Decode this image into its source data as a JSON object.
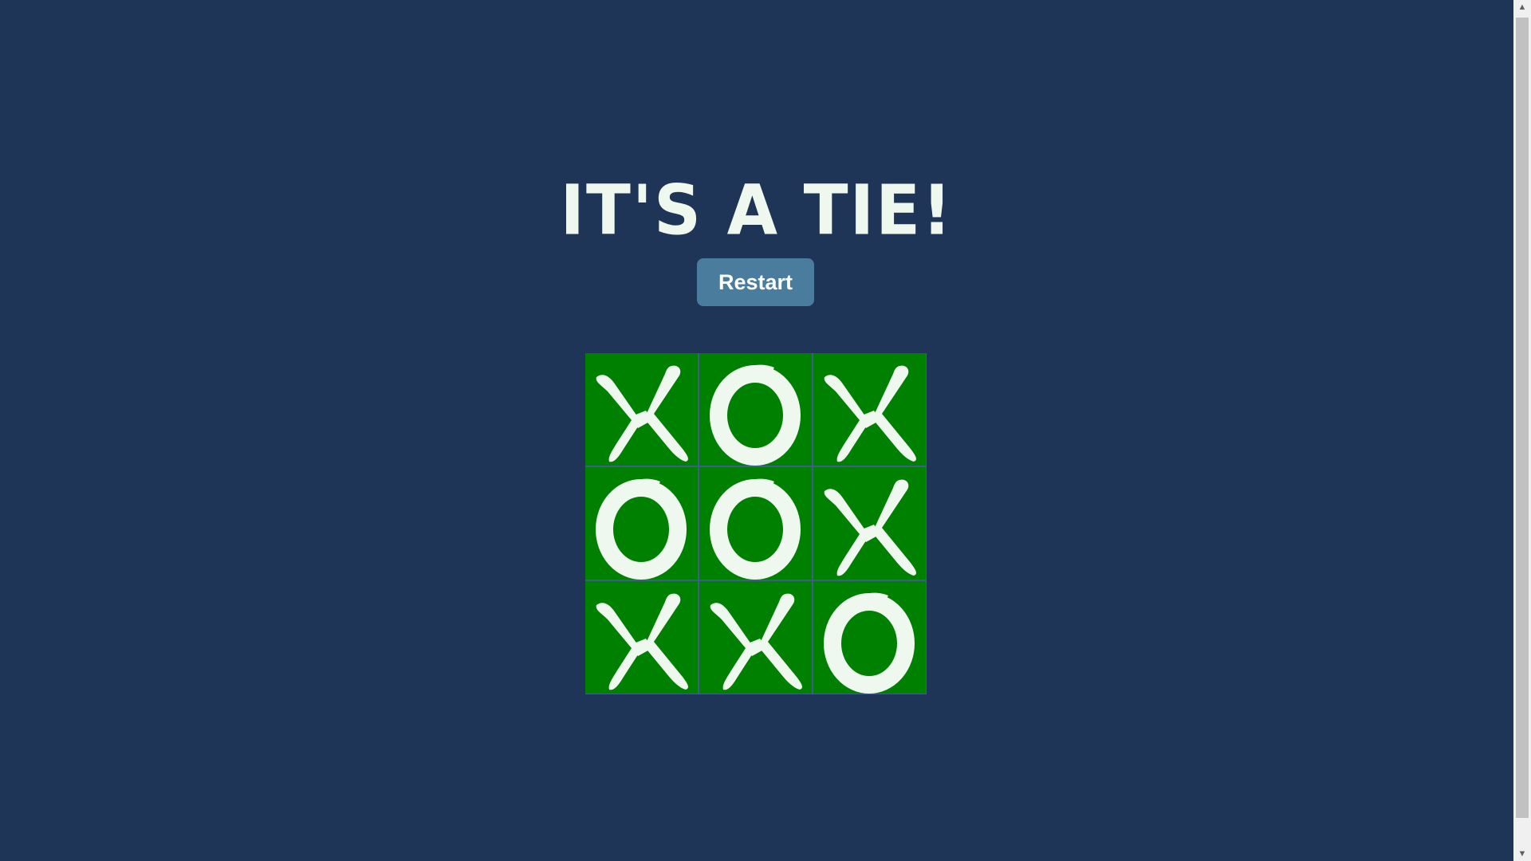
{
  "game": {
    "status_text": "IT'S A TIE!",
    "restart_label": "Restart",
    "board": [
      [
        "X",
        "O",
        "X"
      ],
      [
        "O",
        "O",
        "X"
      ],
      [
        "X",
        "X",
        "O"
      ]
    ]
  },
  "colors": {
    "background": "#1f3557",
    "cell": "#008000",
    "mark": "#eef8ee",
    "button": "#4a7c9e"
  },
  "icons": {
    "x_mark": "brush-x-icon",
    "o_mark": "brush-o-icon",
    "scroll_up": "triangle-up-icon",
    "scroll_down": "triangle-down-icon"
  }
}
